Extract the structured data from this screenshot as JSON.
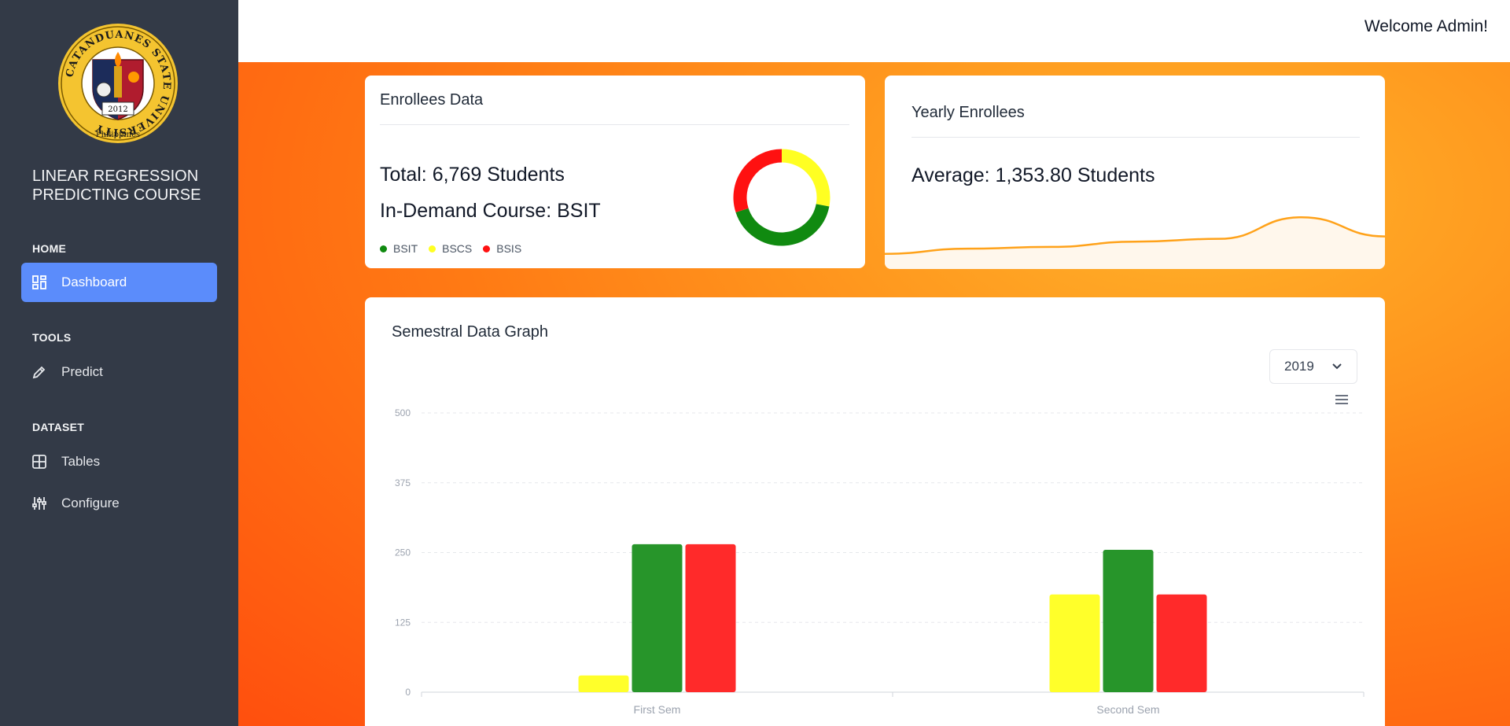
{
  "sidebar": {
    "logo": {
      "ring_text": "CATANDUANES STATE UNIVERSITY",
      "bottom_text": "Philippines",
      "year": "2012"
    },
    "app_title_line1": "LINEAR REGRESSION",
    "app_title_line2": "PREDICTING COURSE",
    "sections": [
      {
        "heading": "HOME",
        "items": [
          {
            "label": "Dashboard",
            "icon": "dashboard-icon",
            "active": true
          }
        ]
      },
      {
        "heading": "TOOLS",
        "items": [
          {
            "label": "Predict",
            "icon": "pencil-icon",
            "active": false
          }
        ]
      },
      {
        "heading": "DATASET",
        "items": [
          {
            "label": "Tables",
            "icon": "table-icon",
            "active": false
          },
          {
            "label": "Configure",
            "icon": "sliders-icon",
            "active": false
          }
        ]
      }
    ]
  },
  "header": {
    "welcome": "Welcome Admin!"
  },
  "enrollees_card": {
    "title": "Enrollees Data",
    "total": "Total: 6,769 Students",
    "in_demand": "In-Demand Course: BSIT",
    "legend": [
      {
        "label": "BSIT",
        "color": "#108a10"
      },
      {
        "label": "BSCS",
        "color": "#ffff22"
      },
      {
        "label": "BSIS",
        "color": "#ff1111"
      }
    ]
  },
  "yearly_card": {
    "title": "Yearly Enrollees",
    "average": "Average: 1,353.80 Students"
  },
  "semestral_card": {
    "title": "Semestral Data Graph",
    "year_selected": "2019"
  },
  "chart_data": [
    {
      "type": "pie",
      "variant": "donut",
      "labels": [
        "BSIT",
        "BSCS",
        "BSIS"
      ],
      "values": [
        42,
        28,
        30
      ],
      "colors": [
        "#108a10",
        "#ffff22",
        "#ff1111"
      ]
    },
    {
      "type": "area",
      "x": [
        1,
        2,
        3,
        4,
        5,
        6,
        7
      ],
      "y": [
        900,
        1050,
        1100,
        1250,
        1330,
        1950,
        1400
      ],
      "color": "#ffa21a"
    },
    {
      "type": "bar",
      "categories": [
        "First Sem",
        "Second Sem"
      ],
      "series": [
        {
          "name": "BSCS",
          "values": [
            30,
            175
          ],
          "color": "#ffff2a"
        },
        {
          "name": "BSIT",
          "values": [
            265,
            255
          ],
          "color": "#27952a"
        },
        {
          "name": "BSIS",
          "values": [
            265,
            175
          ],
          "color": "#ff2a2a"
        }
      ],
      "yticks": [
        0,
        125,
        250,
        375,
        500
      ],
      "ylim": [
        0,
        500
      ],
      "grid": true
    }
  ]
}
